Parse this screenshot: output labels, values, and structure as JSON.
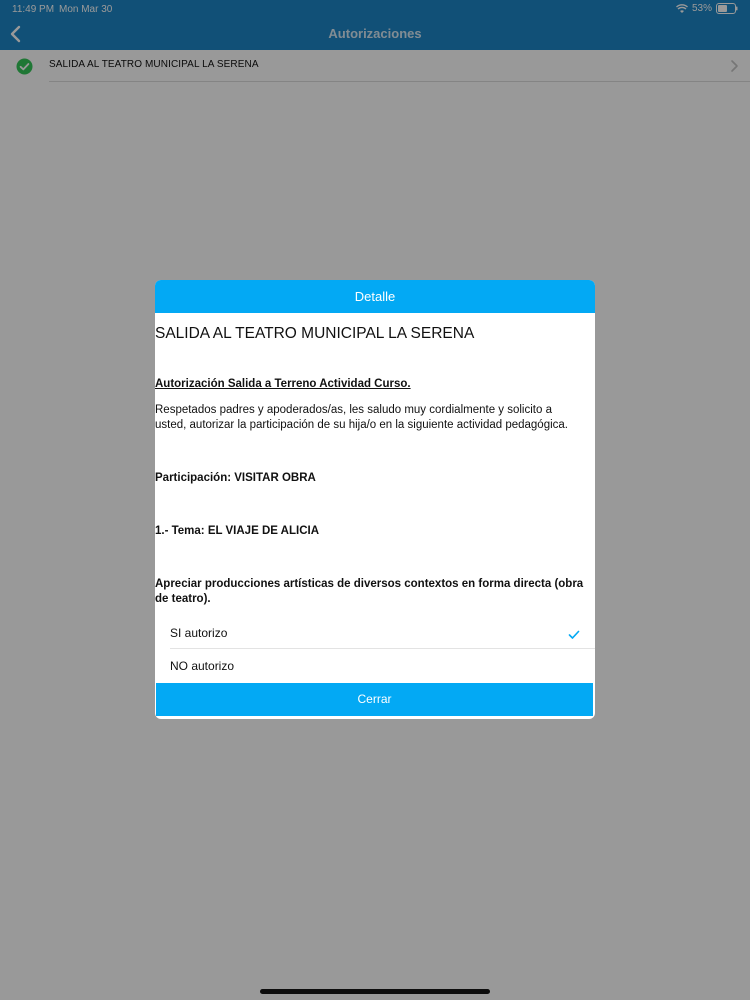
{
  "status_bar": {
    "time": "11:49 PM",
    "date": "Mon Mar 30",
    "battery": "53%"
  },
  "nav": {
    "title": "Autorizaciones"
  },
  "list": {
    "items": [
      {
        "label": "SALIDA AL TEATRO MUNICIPAL LA SERENA",
        "status": "approved"
      }
    ]
  },
  "modal": {
    "header": "Detalle",
    "title": "SALIDA AL TEATRO MUNICIPAL LA SERENA",
    "subheading": "Autorización Salida a Terreno Actividad Curso.",
    "paragraph": "Respetados padres y apoderados/as, les saludo muy cordialmente y solicito a usted, autorizar la participación de su hija/o en la siguiente actividad pedagógica.",
    "participation": "Participación:  VISITAR OBRA",
    "topic": "1.- Tema: EL VIAJE DE ALICIA",
    "objective": "Apreciar producciones artísticas de diversos contextos en forma directa (obra de teatro).",
    "options": [
      {
        "label": "SI autorizo",
        "selected": true
      },
      {
        "label": "NO autorizo",
        "selected": false
      }
    ],
    "close_label": "Cerrar"
  },
  "colors": {
    "nav_bar": "#1d86c6",
    "modal_accent": "#03a9f4",
    "check_green": "#34c759"
  }
}
